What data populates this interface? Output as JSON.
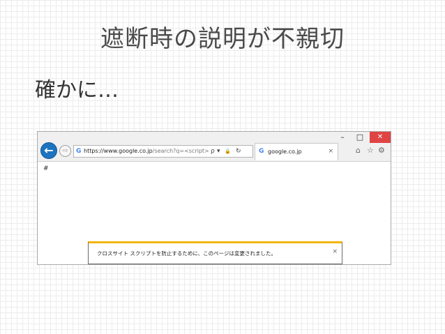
{
  "slide": {
    "title": "遮断時の説明が不親切",
    "body": "確かに…"
  },
  "browser": {
    "window_controls": {
      "minimize": "–",
      "maximize": "□",
      "close": "✕"
    },
    "nav": {
      "back_glyph": "←",
      "forward_glyph": "⇨"
    },
    "address": {
      "favicon": "G",
      "url_prefix": "https://www.",
      "url_host": "google.co.jp",
      "url_path": "/search?q=<script>",
      "search_icon": "ρ",
      "dropdown_icon": "▾",
      "lock_icon": "🔒",
      "refresh_icon": "↻"
    },
    "tab": {
      "favicon": "G",
      "label": "google.co.jp",
      "close": "×"
    },
    "toolbar": {
      "home_icon": "⌂",
      "favorites_icon": "☆",
      "settings_icon": "⚙"
    },
    "page_text": "#",
    "infobar": {
      "message": "クロスサイト スクリプトを防止するために、このページは変更されました。",
      "close": "×"
    },
    "colors": {
      "back_button": "#1e73be",
      "close_button": "#e04343",
      "infobar_accent": "#f2b50f"
    }
  }
}
